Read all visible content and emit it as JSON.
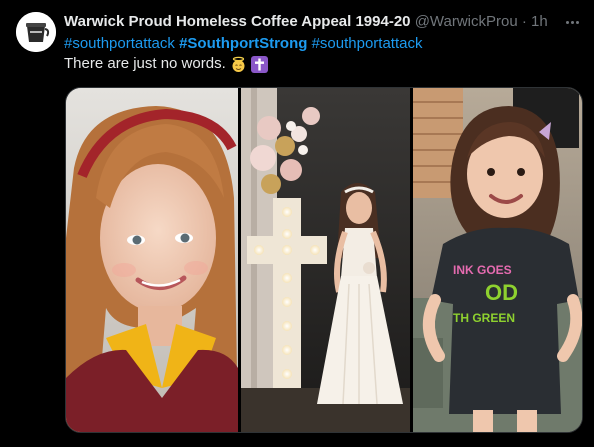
{
  "post": {
    "display_name": "Warwick Proud Homeless Coffee Appeal 1994-20",
    "handle": "@WarwickProu",
    "separator": "·",
    "time": "1h",
    "hashtags": [
      "#southportattack",
      "#SouthportStrong",
      "#southportattack"
    ],
    "text": "There are just no words.",
    "emojis": [
      "angel-emoji",
      "latin-cross-emoji"
    ],
    "media": [
      {
        "name": "school-portrait-photo"
      },
      {
        "name": "communion-dress-photo"
      },
      {
        "name": "tshirt-photo",
        "shirt_text": [
          "INK GOES",
          "OD",
          "TH GREEN"
        ]
      }
    ]
  },
  "colors": {
    "background": "#000000",
    "text": "#e7e9ea",
    "muted": "#71767b",
    "link": "#1d9bf0",
    "border": "#2f3336"
  }
}
